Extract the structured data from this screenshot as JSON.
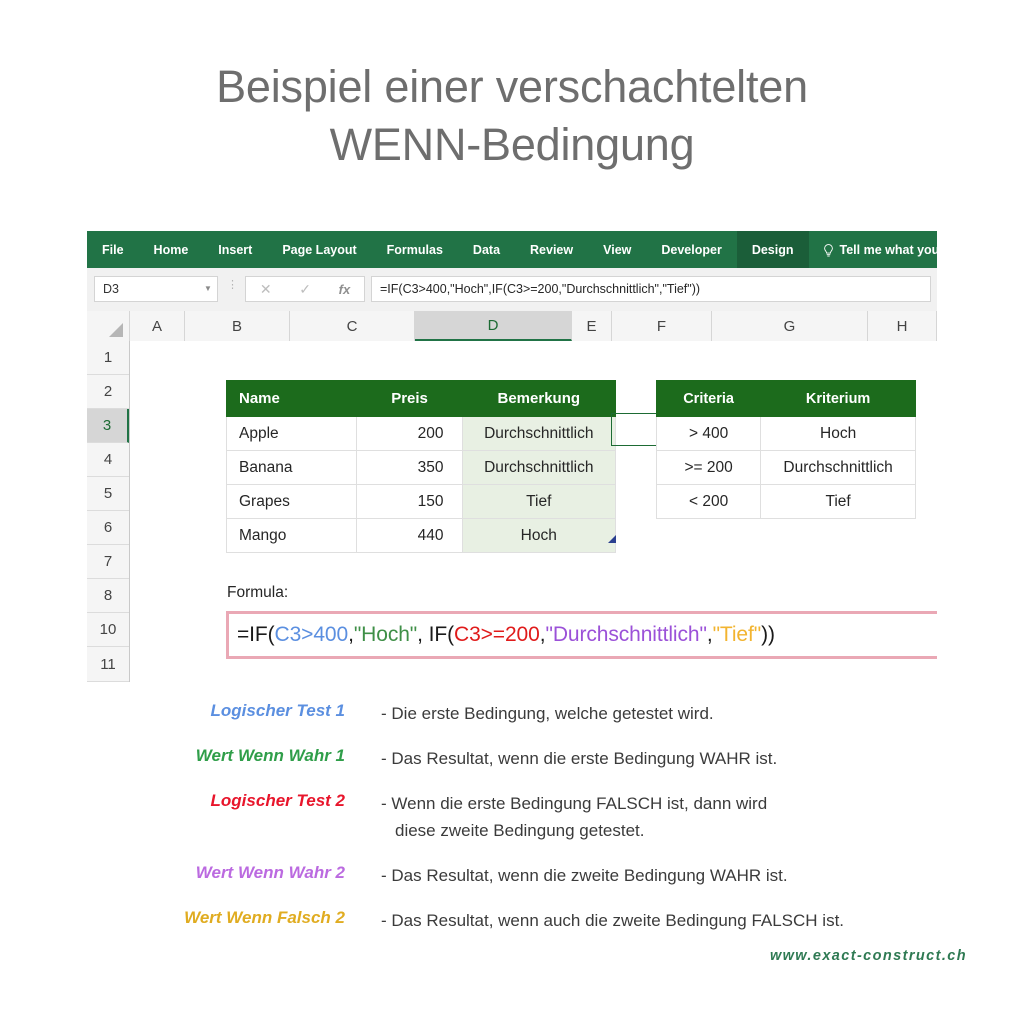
{
  "title": {
    "line1": "Beispiel einer verschachtelten",
    "line2": "WENN-Bedingung"
  },
  "excel": {
    "ribbon": {
      "tabs": [
        {
          "label": "File",
          "active": false
        },
        {
          "label": "Home",
          "active": false
        },
        {
          "label": "Insert",
          "active": false
        },
        {
          "label": "Page Layout",
          "active": false
        },
        {
          "label": "Formulas",
          "active": false
        },
        {
          "label": "Data",
          "active": false
        },
        {
          "label": "Review",
          "active": false
        },
        {
          "label": "View",
          "active": false
        },
        {
          "label": "Developer",
          "active": false
        },
        {
          "label": "Design",
          "active": true
        }
      ],
      "tell_me": "Tell me what you",
      "accent_color": "#217346",
      "active_tab_color": "#1b5e39"
    },
    "formula_bar": {
      "name_box_value": "D3",
      "cancel_icon": "cancel-x-icon",
      "confirm_icon": "check-icon",
      "function_icon": "fx-icon",
      "formula_value": "=IF(C3>400,\"Hoch\",IF(C3>=200,\"Durchschnittlich\",\"Tief\"))"
    },
    "columns": [
      "A",
      "B",
      "C",
      "D",
      "E",
      "F",
      "G",
      "H"
    ],
    "selected_column": "D",
    "rows": [
      "1",
      "2",
      "3",
      "4",
      "5",
      "6",
      "7",
      "8",
      "10",
      "11"
    ],
    "selected_row": "3",
    "data_table": {
      "headers": [
        "Name",
        "Preis",
        "Bemerkung"
      ],
      "rows": [
        {
          "name": "Apple",
          "preis": "200",
          "bemerkung": "Durchschnittlich"
        },
        {
          "name": "Banana",
          "preis": "350",
          "bemerkung": "Durchschnittlich"
        },
        {
          "name": "Grapes",
          "preis": "150",
          "bemerkung": "Tief"
        },
        {
          "name": "Mango",
          "preis": "440",
          "bemerkung": "Hoch"
        }
      ],
      "header_color": "#1c6b1c",
      "result_cell_color": "#e8f0e3"
    },
    "criteria_table": {
      "headers": [
        "Criteria",
        "Kriterium"
      ],
      "rows": [
        {
          "criteria": "> 400",
          "kriterium": "Hoch"
        },
        {
          "criteria": ">= 200",
          "kriterium": "Durchschnittlich"
        },
        {
          "criteria": "< 200",
          "kriterium": "Tief"
        }
      ],
      "header_color": "#1c6b1c"
    },
    "formula_section": {
      "label": "Formula:",
      "border_color": "#eaa8b5",
      "parts": {
        "p1": "=IF( ",
        "p2": "C3>400",
        "p3": ", ",
        "p4": "\"Hoch\"",
        "p5": ", IF( ",
        "p6": "C3>=200",
        "p7": ", ",
        "p8": "\"Durchschnittlich\"",
        "p9": ", ",
        "p10": "\"Tief\"",
        "p11": "))"
      },
      "colors": {
        "logical_test_1": "#5b8fe0",
        "value_if_true_1": "#3f8f47",
        "logical_test_2": "#e01b1b",
        "value_if_true_2": "#9b51d8",
        "value_if_false_2": "#f2b430"
      }
    }
  },
  "legend": {
    "items": [
      {
        "label": "Logischer Test 1",
        "color": "#5b8fe0",
        "desc_line1": "- Die erste Bedingung, welche getestet wird.",
        "desc_line2": ""
      },
      {
        "label": "Wert Wenn Wahr 1",
        "color": "#2f9e49",
        "desc_line1": "- Das Resultat, wenn die erste Bedingung WAHR ist.",
        "desc_line2": ""
      },
      {
        "label": "Logischer Test 2",
        "color": "#e8152b",
        "desc_line1": "- Wenn die erste Bedingung FALSCH ist, dann wird",
        "desc_line2": "diese zweite Bedingung getestet."
      },
      {
        "label": "Wert Wenn Wahr 2",
        "color": "#bb6ae0",
        "desc_line1": "- Das Resultat, wenn die zweite Bedingung WAHR ist.",
        "desc_line2": ""
      },
      {
        "label": "Wert Wenn Falsch 2",
        "color": "#e0ac21",
        "desc_line1": "- Das Resultat, wenn auch die zweite Bedingung FALSCH ist.",
        "desc_line2": ""
      }
    ]
  },
  "footer": {
    "website": "www.exact-construct.ch",
    "color": "#2f7a53"
  }
}
